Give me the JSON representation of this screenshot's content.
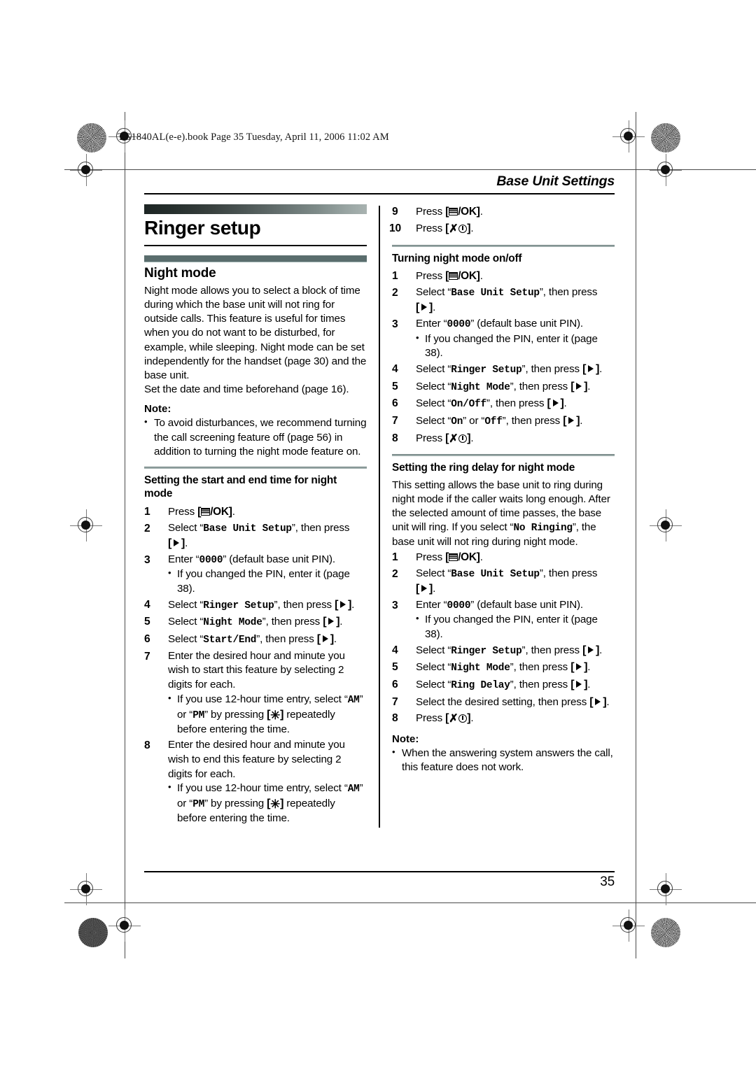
{
  "printer_header": "TG1840AL(e-e).book  Page 35  Tuesday, April 11, 2006  11:02 AM",
  "running_head": "Base Unit Settings",
  "chapter_title": "Ringer setup",
  "page_number": "35",
  "keys": {
    "menu_ok_label": "/OK",
    "menu_icon": "menu-list-icon",
    "right_arrow_icon": "right-arrow-icon",
    "offhook_glyph": "✗",
    "power_icon": "power-icon",
    "star_glyph": "✳"
  },
  "left_column": {
    "feature_title": "Night mode",
    "intro_paragraphs": [
      "Night mode allows you to select a block of time during which the base unit will not ring for outside calls. This feature is useful for times when you do not want to be disturbed, for example, while sleeping. Night mode can be set independently for the handset (page 30) and the base unit.",
      "Set the date and time beforehand (page 16)."
    ],
    "note_label": "Note:",
    "notes": [
      "To avoid disturbances, we recommend turning the call screening feature off (page 56) in addition to turning the night mode feature on."
    ],
    "section_title": "Setting the start and end time for night mode",
    "steps": [
      {
        "num": "1",
        "pre": "Press ",
        "key": "menu_ok",
        "post": "."
      },
      {
        "num": "2",
        "pre": "Select “",
        "lcd": "Base Unit Setup",
        "mid": "”, then press ",
        "key": "right",
        "post": "."
      },
      {
        "num": "3",
        "pre": "Enter “",
        "lcd": "0000",
        "mid": "” (default base unit PIN).",
        "sub": [
          "If you changed the PIN, enter it (page 38)."
        ]
      },
      {
        "num": "4",
        "pre": "Select “",
        "lcd": "Ringer Setup",
        "mid": "”, then press ",
        "key": "right",
        "post": "."
      },
      {
        "num": "5",
        "pre": "Select “",
        "lcd": "Night Mode",
        "mid": "”, then press ",
        "key": "right",
        "post": "."
      },
      {
        "num": "6",
        "pre": "Select “",
        "lcd": "Start/End",
        "mid": "”, then press ",
        "key": "right",
        "post": "."
      },
      {
        "num": "7",
        "pre": "Enter the desired hour and minute you wish to start this feature by selecting 2 digits for each.",
        "sub_rich": "am_pm"
      },
      {
        "num": "8",
        "pre": "Enter the desired hour and minute you wish to end this feature by selecting 2 digits for each.",
        "sub_rich": "am_pm"
      }
    ],
    "am_pm_note": {
      "lead": "If you use 12-hour time entry, select “",
      "am": "AM",
      "mid": "” or “",
      "pm": "PM",
      "after": "” by pressing ",
      "tail": " repeatedly before entering the time."
    }
  },
  "right_column": {
    "continued_steps": [
      {
        "num": "9",
        "pre": "Press ",
        "key": "menu_ok",
        "post": "."
      },
      {
        "num": "10",
        "pre": "Press ",
        "key": "offhook",
        "post": "."
      }
    ],
    "section2_title": "Turning night mode on/off",
    "section2_steps": [
      {
        "num": "1",
        "pre": "Press ",
        "key": "menu_ok",
        "post": "."
      },
      {
        "num": "2",
        "pre": "Select “",
        "lcd": "Base Unit Setup",
        "mid": "”, then press ",
        "key": "right",
        "post": "."
      },
      {
        "num": "3",
        "pre": "Enter “",
        "lcd": "0000",
        "mid": "” (default base unit PIN).",
        "sub": [
          "If you changed the PIN, enter it (page 38)."
        ]
      },
      {
        "num": "4",
        "pre": "Select “",
        "lcd": "Ringer Setup",
        "mid": "”, then press ",
        "key": "right",
        "post": "."
      },
      {
        "num": "5",
        "pre": "Select “",
        "lcd": "Night Mode",
        "mid": "”, then press ",
        "key": "right",
        "post": "."
      },
      {
        "num": "6",
        "pre": "Select “",
        "lcd": "On/Off",
        "mid": "”, then press ",
        "key": "right",
        "post": "."
      },
      {
        "num": "7",
        "pre": "Select “",
        "lcd": "On",
        "mid": "” or “",
        "lcd2": "Off",
        "mid2": "”, then press ",
        "key": "right",
        "post": "."
      },
      {
        "num": "8",
        "pre": "Press ",
        "key": "offhook",
        "post": "."
      }
    ],
    "section3_title": "Setting the ring delay for night mode",
    "section3_intro_a": "This setting allows the base unit to ring during night mode if the caller waits long enough. After the selected amount of time passes, the base unit will ring. If you select “",
    "section3_intro_lcd": "No Ringing",
    "section3_intro_b": "”, the base unit will not ring during night mode.",
    "section3_steps": [
      {
        "num": "1",
        "pre": "Press ",
        "key": "menu_ok",
        "post": "."
      },
      {
        "num": "2",
        "pre": "Select “",
        "lcd": "Base Unit Setup",
        "mid": "”, then press ",
        "key": "right",
        "post": "."
      },
      {
        "num": "3",
        "pre": "Enter “",
        "lcd": "0000",
        "mid": "” (default base unit PIN).",
        "sub": [
          "If you changed the PIN, enter it (page 38)."
        ]
      },
      {
        "num": "4",
        "pre": "Select “",
        "lcd": "Ringer Setup",
        "mid": "”, then press ",
        "key": "right",
        "post": "."
      },
      {
        "num": "5",
        "pre": "Select “",
        "lcd": "Night Mode",
        "mid": "”, then press ",
        "key": "right",
        "post": "."
      },
      {
        "num": "6",
        "pre": "Select “",
        "lcd": "Ring Delay",
        "mid": "”, then press ",
        "key": "right",
        "post": "."
      },
      {
        "num": "7",
        "pre": "Select the desired setting, then press ",
        "key": "right",
        "post": "."
      },
      {
        "num": "8",
        "pre": "Press ",
        "key": "offhook",
        "post": "."
      }
    ],
    "note_label": "Note:",
    "notes": [
      "When the answering system answers the call, this feature does not work."
    ]
  }
}
